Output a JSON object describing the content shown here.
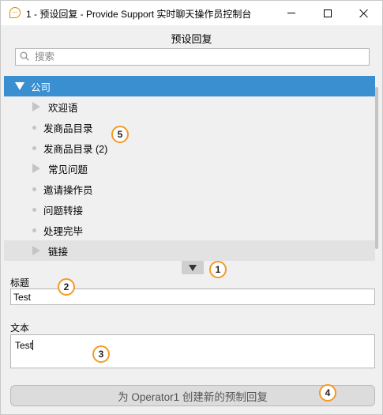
{
  "window": {
    "icon": "chat-bubble-icon",
    "title": "1 - 预设回复 - Provide Support 实时聊天操作员控制台",
    "controls": [
      "minimize-icon",
      "maximize-icon",
      "close-icon"
    ]
  },
  "panel": {
    "title": "预设回复"
  },
  "search": {
    "placeholder": "搜索",
    "value": ""
  },
  "tree": {
    "items": [
      {
        "label": "公司",
        "kind": "expanded-folder",
        "selected": true
      },
      {
        "label": "欢迎语",
        "kind": "collapsed-folder"
      },
      {
        "label": "发商品目录",
        "kind": "leaf"
      },
      {
        "label": "发商品目录 (2)",
        "kind": "leaf"
      },
      {
        "label": "常见问题",
        "kind": "collapsed-folder"
      },
      {
        "label": "邀请操作员",
        "kind": "leaf"
      },
      {
        "label": "问题转接",
        "kind": "leaf"
      },
      {
        "label": "处理完毕",
        "kind": "leaf"
      },
      {
        "label": "链接",
        "kind": "collapsed-folder",
        "hover": true
      }
    ]
  },
  "form": {
    "title_label": "标题",
    "title_value": "Test",
    "text_label": "文本",
    "text_value": "Test",
    "create_button": "为 Operator1 创建新的预制回复"
  },
  "callouts": [
    "1",
    "2",
    "3",
    "4",
    "5"
  ],
  "colors": {
    "selection": "#3a8fd0",
    "callout_border": "#f39a26",
    "app_icon": "#e08a00"
  }
}
